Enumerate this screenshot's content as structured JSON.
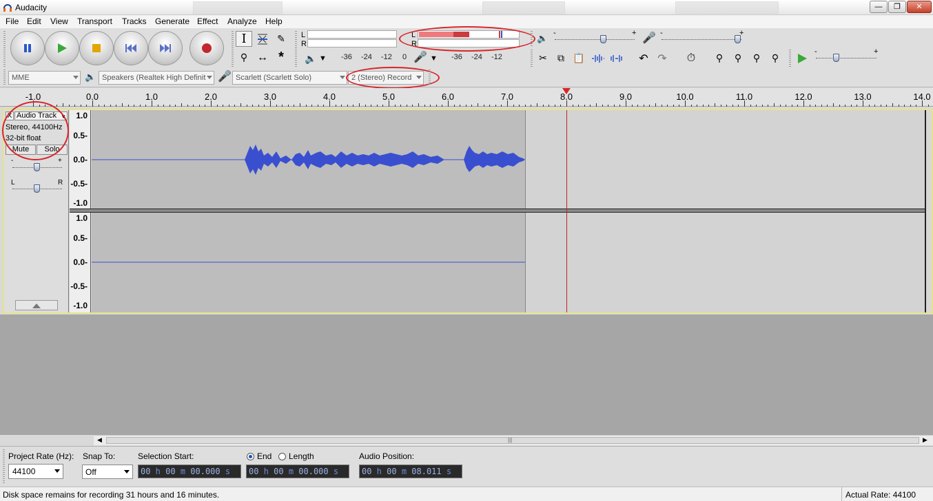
{
  "window": {
    "title": "Audacity"
  },
  "menu": [
    "File",
    "Edit",
    "View",
    "Transport",
    "Tracks",
    "Generate",
    "Effect",
    "Analyze",
    "Help"
  ],
  "meters": {
    "rec_l": "L",
    "rec_r": "R",
    "play_l": "L",
    "play_r": "R",
    "ticks": [
      "-36",
      "-24",
      "-12",
      "0"
    ],
    "ticks2": [
      "-36",
      "-24",
      "-12"
    ],
    "mix_minus": "-",
    "mix_plus": "+"
  },
  "devices": {
    "host": "MME",
    "output": "Speakers (Realtek High Definit",
    "input": "Scarlett (Scarlett Solo)",
    "channels": "2 (Stereo) Record"
  },
  "ruler": {
    "labels": [
      "-1.0",
      "0.0",
      "1.0",
      "2.0",
      "3.0",
      "4.0",
      "5.0",
      "6.0",
      "7.0",
      "8.0",
      "9.0",
      "10.0",
      "11.0",
      "12.0",
      "13.0",
      "14.0"
    ],
    "playhead_seconds": 8.0
  },
  "track": {
    "name": "Audio Track",
    "close": "X",
    "format": "Stereo, 44100Hz",
    "bitdepth": "32-bit float",
    "mute": "Mute",
    "solo": "Solo",
    "gain_minus": "-",
    "gain_plus": "+",
    "pan_l": "L",
    "pan_r": "R",
    "scale_labels": [
      "1.0",
      "0.5-",
      "0.0-",
      "-0.5-",
      "-1.0"
    ]
  },
  "selection": {
    "project_rate_label": "Project Rate (Hz):",
    "project_rate": "44100",
    "snap_label": "Snap To:",
    "snap_value": "Off",
    "start_label": "Selection Start:",
    "end_label": "End",
    "length_label": "Length",
    "position_label": "Audio Position:",
    "start": [
      "00",
      "00",
      "00.000"
    ],
    "end": [
      "00",
      "00",
      "00.000"
    ],
    "position": [
      "00",
      "00",
      "08.011"
    ]
  },
  "status": {
    "disk": "Disk space remains for recording 31 hours and 16 minutes.",
    "rate": "Actual Rate: 44100"
  },
  "colors": {
    "waveform": "#3a4fd0",
    "highlight": "#d8242a",
    "meter": "#e8555a"
  }
}
